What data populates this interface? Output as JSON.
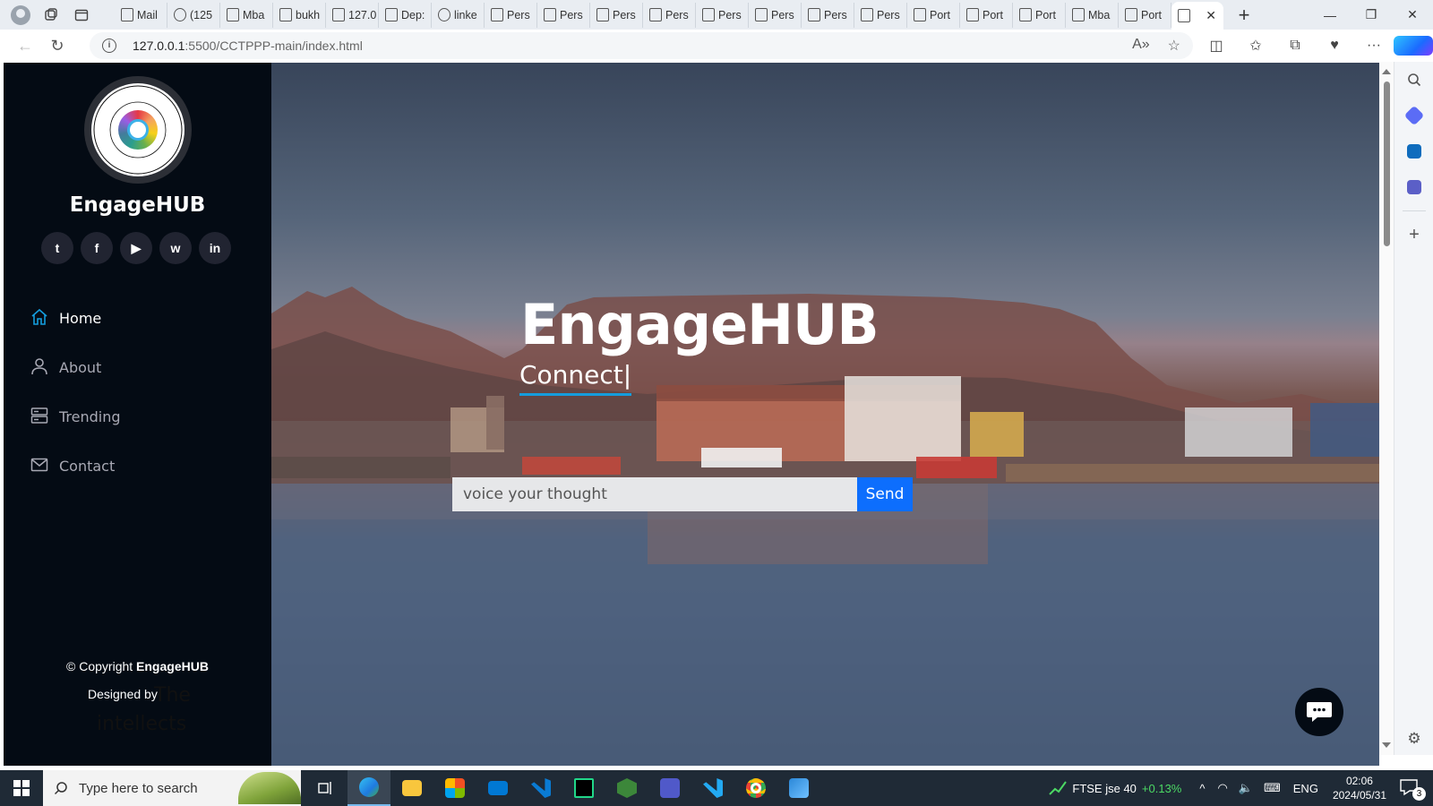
{
  "browser": {
    "tabs": [
      {
        "label": "Mail"
      },
      {
        "label": "(125"
      },
      {
        "label": "Mba"
      },
      {
        "label": "bukh"
      },
      {
        "label": "127.0"
      },
      {
        "label": "Dep:"
      },
      {
        "label": "linke"
      },
      {
        "label": "Pers"
      },
      {
        "label": "Pers"
      },
      {
        "label": "Pers"
      },
      {
        "label": "Pers"
      },
      {
        "label": "Pers"
      },
      {
        "label": "Pers"
      },
      {
        "label": "Pers"
      },
      {
        "label": "Pers"
      },
      {
        "label": "Port"
      },
      {
        "label": "Port"
      },
      {
        "label": "Port"
      },
      {
        "label": "Mba"
      },
      {
        "label": "Port"
      }
    ],
    "url_host": "127.0.0.1",
    "url_path": ":5500/CCTPPP-main/index.html"
  },
  "sidebar": {
    "brand": "EngageHUB",
    "socials": [
      {
        "icon": "twitter-icon",
        "glyph": "t"
      },
      {
        "icon": "facebook-icon",
        "glyph": "f"
      },
      {
        "icon": "youtube-icon",
        "glyph": "▶"
      },
      {
        "icon": "whatsapp-icon",
        "glyph": "w"
      },
      {
        "icon": "linkedin-icon",
        "glyph": "in"
      }
    ],
    "nav": [
      {
        "label": "Home",
        "icon": "house-icon",
        "active": true
      },
      {
        "label": "About",
        "icon": "person-icon",
        "active": false
      },
      {
        "label": "Trending",
        "icon": "server-icon",
        "active": false
      },
      {
        "label": "Contact",
        "icon": "envelope-icon",
        "active": false
      }
    ],
    "copyright_prefix": "© Copyright",
    "copyright_brand": "EngageHUB",
    "designed_by": "Designed by",
    "designer": "The intellects"
  },
  "hero": {
    "title": "EngageHUB",
    "subtitle": "Connect",
    "cursor": "|",
    "input_placeholder": "voice your thought",
    "send_label": "Send"
  },
  "taskbar": {
    "search_placeholder": "Type here to search",
    "ticker_name": "FTSE jse 40",
    "ticker_change": "+0.13%",
    "language": "ENG",
    "time": "02:06",
    "date": "2024/05/31",
    "notifications": "3"
  },
  "colors": {
    "sidebar_bg": "#040b14",
    "accent_blue": "#149ddd",
    "send_blue": "#0d6efd"
  }
}
